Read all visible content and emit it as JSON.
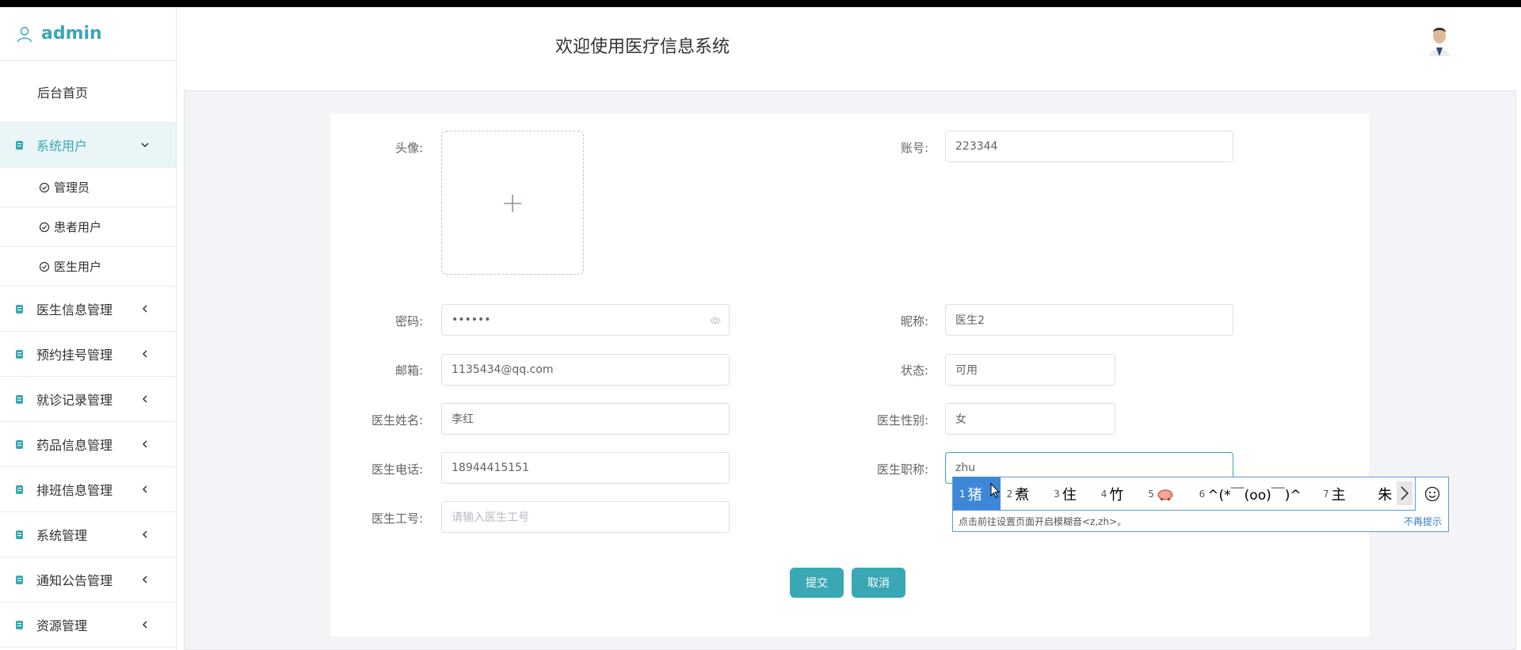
{
  "app": {
    "user": "admin",
    "header_title": "欢迎使用医疗信息系统"
  },
  "colors": {
    "accent": "#3aa7b4",
    "ime_highlight": "#3d87d8"
  },
  "sidebar": {
    "home": "后台首页",
    "active_group": "系统用户",
    "active_sub": [
      "管理员",
      "患者用户",
      "医生用户"
    ],
    "groups": [
      "医生信息管理",
      "预约挂号管理",
      "就诊记录管理",
      "药品信息管理",
      "排班信息管理",
      "系统管理",
      "通知公告管理",
      "资源管理"
    ]
  },
  "form": {
    "avatar_label": "头像:",
    "account_label": "账号:",
    "account_value": "223344",
    "password_label": "密码:",
    "password_value": "••••••",
    "nickname_label": "昵称:",
    "nickname_value": "医生2",
    "email_label": "邮箱:",
    "email_value": "1135434@qq.com",
    "status_label": "状态:",
    "status_value": "可用",
    "doctor_name_label": "医生姓名:",
    "doctor_name_value": "李红",
    "doctor_gender_label": "医生性别:",
    "doctor_gender_value": "女",
    "doctor_phone_label": "医生电话:",
    "doctor_phone_value": "18944415151",
    "doctor_title_label": "医生职称:",
    "doctor_title_value": "zhu",
    "doctor_id_label": "医生工号:",
    "doctor_id_placeholder": "请输入医生工号",
    "submit": "提交",
    "cancel": "取消"
  },
  "ime": {
    "candidates": [
      {
        "num": "1",
        "text": "猪"
      },
      {
        "num": "2",
        "text": "煮"
      },
      {
        "num": "3",
        "text": "住"
      },
      {
        "num": "4",
        "text": "竹"
      },
      {
        "num": "5",
        "text": ""
      },
      {
        "num": "6",
        "text": "^(*￣(oo)￣)^"
      },
      {
        "num": "7",
        "text": "主"
      },
      {
        "num": "",
        "text": "朱"
      }
    ],
    "hint": "点击前往设置页面开启模糊音<z,zh>。",
    "dismiss": "不再提示"
  }
}
